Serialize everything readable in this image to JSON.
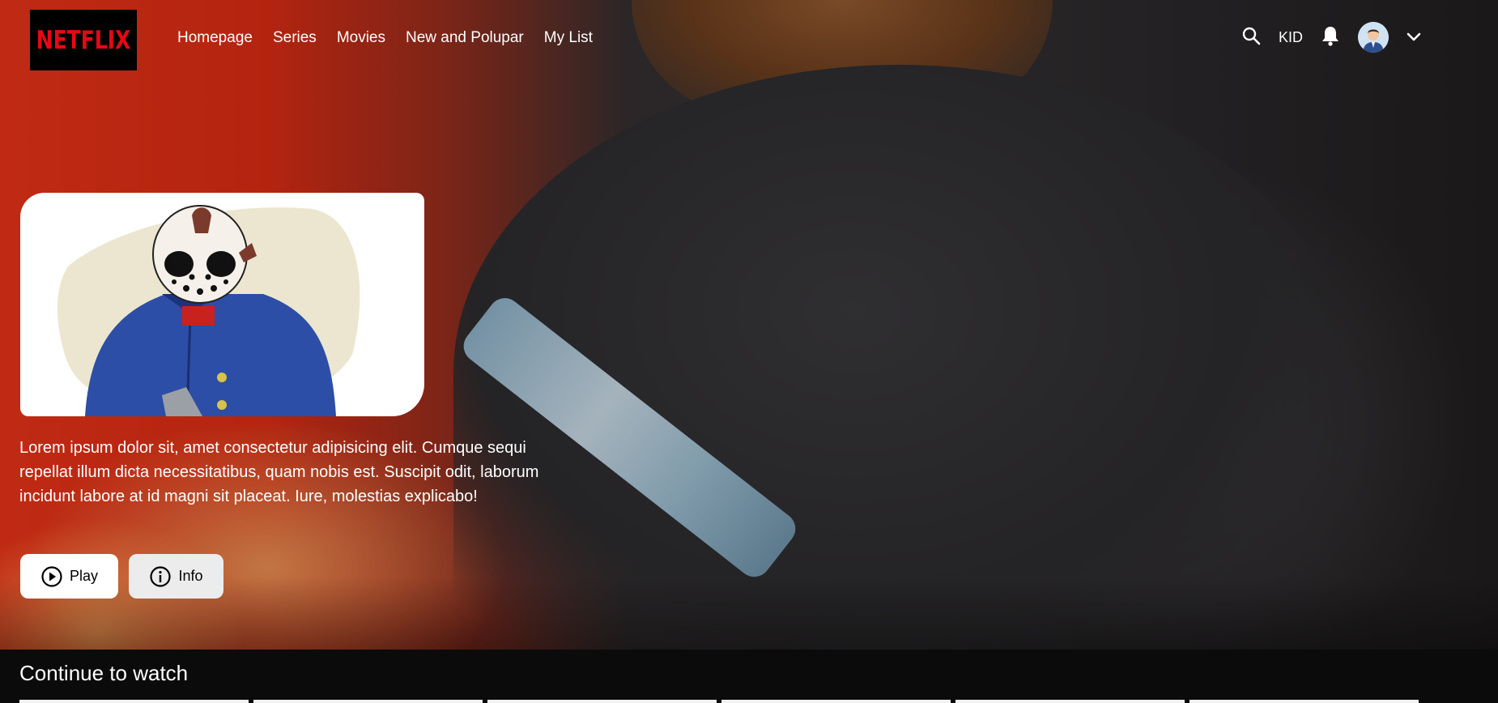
{
  "brand": {
    "logo_text": "NETFLIX",
    "logo_color": "#e50914"
  },
  "nav": {
    "items": [
      {
        "label": "Homepage"
      },
      {
        "label": "Series"
      },
      {
        "label": "Movies"
      },
      {
        "label": "New and Polupar"
      },
      {
        "label": "My List"
      }
    ]
  },
  "header": {
    "search_icon": "search-icon",
    "kid_label": "KID",
    "notification_icon": "bell-icon",
    "avatar_icon": "user-avatar",
    "menu_icon": "chevron-down-icon"
  },
  "featured": {
    "description": "Lorem ipsum dolor sit, amet consectetur adipisicing elit. Cumque sequi repellat illum dicta necessitatibus, quam nobis est. Suscipit odit, laborum incidunt labore at id magni sit placeat. Iure, molestias explicabo!",
    "play_label": "Play",
    "info_label": "Info"
  },
  "sections": {
    "continue_title": "Continue to watch"
  }
}
